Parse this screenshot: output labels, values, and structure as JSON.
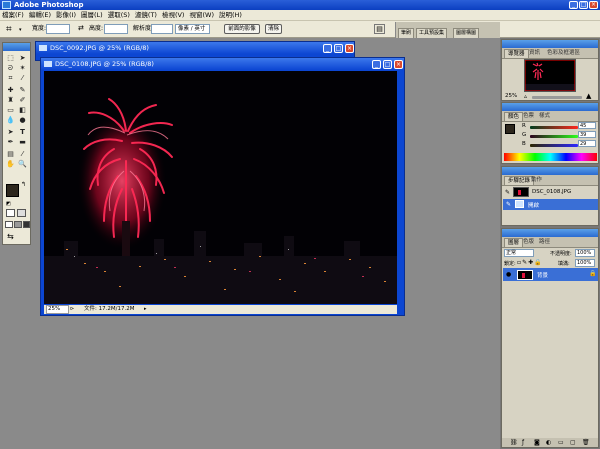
{
  "window": {
    "title": "Adobe Photoshop"
  },
  "menu": [
    "檔案(F)",
    "編輯(E)",
    "影像(I)",
    "圖層(L)",
    "選取(S)",
    "濾鏡(T)",
    "檢視(V)",
    "視窗(W)",
    "說明(H)"
  ],
  "options": {
    "width_label": "寬度:",
    "height_label": "高度:",
    "resolution_label": "解析度:",
    "unit": "像素 / 英寸",
    "front_image_button": "前面的影像",
    "clear_button": "清除"
  },
  "palette_well": {
    "tabs": [
      "筆刷",
      "工具預設集",
      "圖層構圖"
    ]
  },
  "documents": [
    {
      "title": "DSC_0092.JPG @ 25% (RGB/8)"
    },
    {
      "title": "DSC_0108.JPG @ 25% (RGB/8)",
      "zoom": "25%",
      "doc_size": "文件: 17.2M/17.2M"
    }
  ],
  "navigator": {
    "tabs": [
      "導覽器",
      "資訊",
      "色彩及框選區"
    ],
    "zoom": "25%"
  },
  "color": {
    "tabs": [
      "顏色",
      "色票",
      "樣式"
    ],
    "rgb": [
      {
        "label": "R",
        "value": "45"
      },
      {
        "label": "G",
        "value": "39"
      },
      {
        "label": "B",
        "value": "29"
      }
    ],
    "foreground": "#2d271d"
  },
  "history": {
    "tabs": [
      "步驟記錄",
      "動作"
    ],
    "snapshot": "DSC_0108.JPG",
    "step": "開啟"
  },
  "layers": {
    "tabs": [
      "圖層",
      "色版",
      "路徑"
    ],
    "blend_mode": "正常",
    "opacity_label": "不透明度:",
    "opacity": "100%",
    "lock_label": "鎖定:",
    "fill_label": "填滿:",
    "fill": "100%",
    "layer_name": "背景"
  },
  "colors": {
    "accent": "#0c46d2",
    "title_blue": "#2a6ad0",
    "firework_red": "#e0123c"
  }
}
